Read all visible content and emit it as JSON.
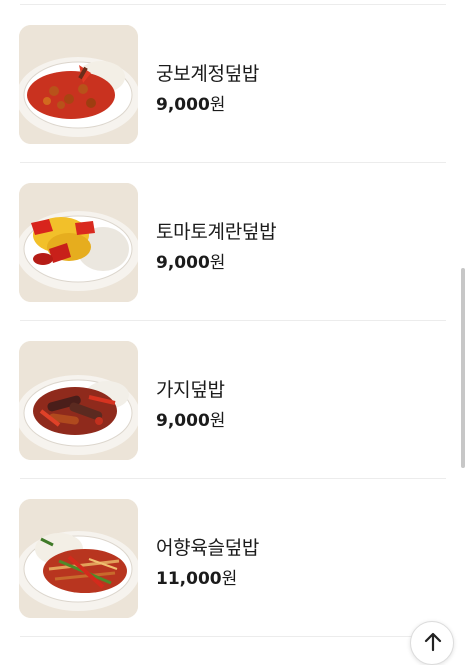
{
  "menu": {
    "items": [
      {
        "name": "궁보계정덮밥",
        "price": "9,000",
        "unit": "원",
        "image": "gungbao-chicken-rice-photo"
      },
      {
        "name": "토마토계란덮밥",
        "price": "9,000",
        "unit": "원",
        "image": "tomato-egg-rice-photo"
      },
      {
        "name": "가지덮밥",
        "price": "9,000",
        "unit": "원",
        "image": "eggplant-rice-photo"
      },
      {
        "name": "어향육슬덮밥",
        "price": "11,000",
        "unit": "원",
        "image": "yuxiang-pork-rice-photo"
      }
    ]
  },
  "controls": {
    "scroll_top_icon": "arrow-up-icon"
  },
  "colors": {
    "background": "#ffffff",
    "text": "#1b1b1b",
    "divider": "#ececec"
  }
}
